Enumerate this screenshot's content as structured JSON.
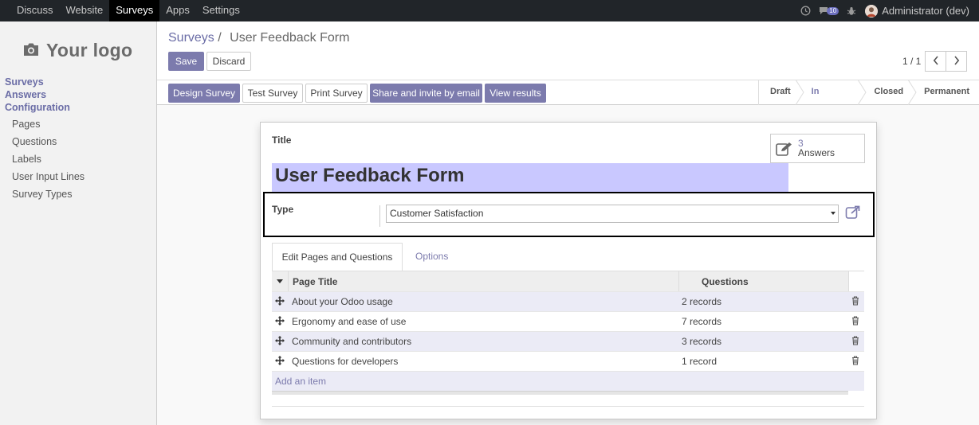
{
  "topbar": {
    "menu": [
      "Discuss",
      "Website",
      "Surveys",
      "Apps",
      "Settings"
    ],
    "active": "Surveys",
    "message_count": "10",
    "user": "Administrator (dev)"
  },
  "sidebar": {
    "logo_text": "Your logo",
    "sections": [
      {
        "label": "Surveys"
      },
      {
        "label": "Answers"
      },
      {
        "label": "Configuration"
      }
    ],
    "config_items": [
      "Pages",
      "Questions",
      "Labels",
      "User Input Lines",
      "Survey Types"
    ]
  },
  "control_panel": {
    "breadcrumb_parent": "Surveys",
    "breadcrumb_sep": "/",
    "breadcrumb_current": "User Feedback Form",
    "save_label": "Save",
    "discard_label": "Discard",
    "pager": "1 / 1",
    "actions": [
      "Design Survey",
      "Test Survey",
      "Print Survey",
      "Share and invite by email",
      "View results"
    ],
    "stages": [
      "Draft",
      "In progress",
      "Closed",
      "Permanent"
    ],
    "current_stage": "In progress"
  },
  "form": {
    "title_label": "Title",
    "title_value": "User Feedback Form",
    "answers_count": "3",
    "answers_label": "Answers",
    "type_label": "Type",
    "type_value": "Customer Satisfaction",
    "tabs": [
      "Edit Pages and Questions",
      "Options"
    ],
    "grid_headers": [
      "Page Title",
      "Questions"
    ],
    "rows": [
      {
        "title": "About your Odoo usage",
        "questions": "2 records"
      },
      {
        "title": "Ergonomy and ease of use",
        "questions": "7 records"
      },
      {
        "title": "Community and contributors",
        "questions": "3 records"
      },
      {
        "title": "Questions for developers",
        "questions": "1 record"
      }
    ],
    "add_item_label": "Add an item"
  },
  "colors": {
    "accent": "#7c7bad",
    "topbar": "#212529",
    "title_highlight": "#c9c8ff"
  }
}
